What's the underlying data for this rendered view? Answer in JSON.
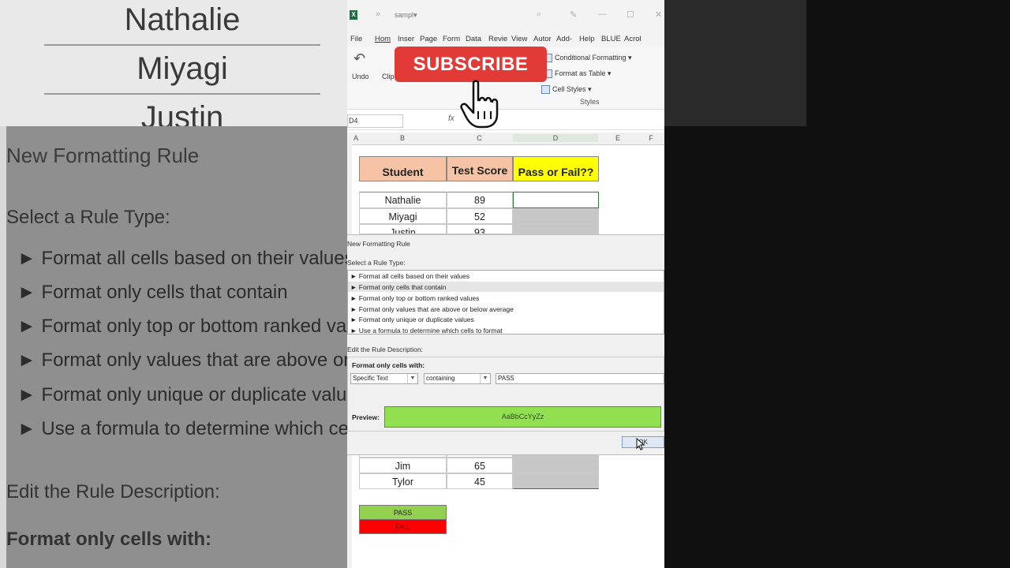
{
  "background": {
    "names": [
      "Nathalie",
      "Miyagi",
      "Justin"
    ],
    "dialog_title": "New Formatting Rule",
    "select_label": "Select a Rule Type:",
    "rules": [
      "► Format all cells based on their values",
      "► Format only cells that contain",
      "► Format only top or bottom ranked values",
      "► Format only values that are above or below average",
      "► Format only unique or duplicate values",
      "► Use a formula to determine which cells to format"
    ],
    "edit_label": "Edit the Rule Description:",
    "format_label": "Format only cells with:"
  },
  "titlebar": {
    "filename": "sampl▾"
  },
  "menu": [
    "File",
    "Hom",
    "Inser",
    "Page",
    "Form",
    "Data",
    "Revie",
    "View",
    "Autor",
    "Add-",
    "Help",
    "BLUE",
    "Acrol"
  ],
  "ribbon": {
    "undo": "Undo",
    "clip": "Clip",
    "conditional_formatting": "Conditional Formatting ▾",
    "format_as_table": "Format as Table ▾",
    "cell_styles": "Cell Styles ▾",
    "styles_group": "Styles"
  },
  "formula_bar": {
    "name_box": "D4",
    "fx": "fx"
  },
  "columns": [
    "A",
    "B",
    "C",
    "D",
    "E",
    "F"
  ],
  "table": {
    "headers": [
      "Student",
      "Test Score",
      "Pass or Fail??"
    ],
    "top_rows": [
      {
        "name": "Nathalie",
        "score": "89"
      },
      {
        "name": "Miyagi",
        "score": "52"
      },
      {
        "name": "Justin",
        "score": "93"
      }
    ],
    "bottom_rows": [
      {
        "name": "Jim",
        "score": "65"
      },
      {
        "name": "Tylor",
        "score": "45"
      }
    ],
    "legend": [
      "PASS",
      "FAIL"
    ]
  },
  "dialog": {
    "title": "New Formatting Rule",
    "select_label": "Select a Rule Type:",
    "rules": [
      "► Format all cells based on their values",
      "► Format only cells that contain",
      "► Format only top or bottom ranked values",
      "► Format only values that are above or below average",
      "► Format only unique or duplicate values",
      "► Use a formula to determine which cells to format"
    ],
    "edit_label": "Edit the Rule Description:",
    "format_label": "Format only cells with:",
    "dropdown1": "Specific Text",
    "dropdown2": "containing",
    "value": "PASS",
    "preview_label": "Preview:",
    "preview_text": "AaBbCcYyZz",
    "ok": "OK"
  },
  "overlay": {
    "subscribe": "SUBSCRIBE"
  },
  "colors": {
    "excel_green": "#1d6f42",
    "header_orange": "#f6c4a4",
    "header_yellow": "#ffff00",
    "pass_green": "#92d050",
    "fail_red": "#ff0000",
    "subscribe_red": "#e23b37"
  }
}
